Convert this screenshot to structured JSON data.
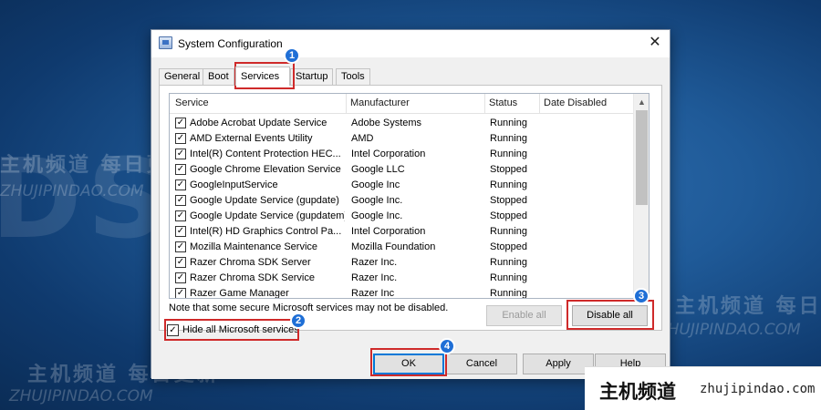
{
  "background_watermarks": {
    "big_brand": "DSTricks",
    "cn_text": "主机频道 每日更新",
    "en_text": "ZHUJIPINDAO.COM"
  },
  "window": {
    "title": "System Configuration",
    "close_glyph": "✕"
  },
  "tabs": [
    "General",
    "Boot",
    "Services",
    "Startup",
    "Tools"
  ],
  "active_tab": "Services",
  "columns": [
    "Service",
    "Manufacturer",
    "Status",
    "Date Disabled"
  ],
  "services": [
    {
      "checked": true,
      "name": "Adobe Acrobat Update Service",
      "manufacturer": "Adobe Systems",
      "status": "Running",
      "date_disabled": ""
    },
    {
      "checked": true,
      "name": "AMD External Events Utility",
      "manufacturer": "AMD",
      "status": "Running",
      "date_disabled": ""
    },
    {
      "checked": true,
      "name": "Intel(R) Content Protection HEC...",
      "manufacturer": "Intel Corporation",
      "status": "Running",
      "date_disabled": ""
    },
    {
      "checked": true,
      "name": "Google Chrome Elevation Service",
      "manufacturer": "Google LLC",
      "status": "Stopped",
      "date_disabled": ""
    },
    {
      "checked": true,
      "name": "GoogleInputService",
      "manufacturer": "Google Inc",
      "status": "Running",
      "date_disabled": ""
    },
    {
      "checked": true,
      "name": "Google Update Service (gupdate)",
      "manufacturer": "Google Inc.",
      "status": "Stopped",
      "date_disabled": ""
    },
    {
      "checked": true,
      "name": "Google Update Service (gupdatem)",
      "manufacturer": "Google Inc.",
      "status": "Stopped",
      "date_disabled": ""
    },
    {
      "checked": true,
      "name": "Intel(R) HD Graphics Control Pa...",
      "manufacturer": "Intel Corporation",
      "status": "Running",
      "date_disabled": ""
    },
    {
      "checked": true,
      "name": "Mozilla Maintenance Service",
      "manufacturer": "Mozilla Foundation",
      "status": "Stopped",
      "date_disabled": ""
    },
    {
      "checked": true,
      "name": "Razer Chroma SDK Server",
      "manufacturer": "Razer Inc.",
      "status": "Running",
      "date_disabled": ""
    },
    {
      "checked": true,
      "name": "Razer Chroma SDK Service",
      "manufacturer": "Razer Inc.",
      "status": "Running",
      "date_disabled": ""
    },
    {
      "checked": true,
      "name": "Razer Game Manager",
      "manufacturer": "Razer Inc",
      "status": "Running",
      "date_disabled": ""
    }
  ],
  "note": "Note that some secure Microsoft services may not be disabled.",
  "buttons": {
    "enable_all": "Enable all",
    "disable_all": "Disable all",
    "ok": "OK",
    "cancel": "Cancel",
    "apply": "Apply",
    "help": "Help"
  },
  "hide_microsoft": {
    "checked": true,
    "label": "Hide all Microsoft services"
  },
  "step_markers": [
    "1",
    "2",
    "3",
    "4"
  ],
  "banner": {
    "cn": "主机频道",
    "en": "zhujipindao.com"
  },
  "colors": {
    "highlight": "#cf2a2a",
    "marker": "#1f6fd6",
    "default_button_border": "#0078d7"
  }
}
